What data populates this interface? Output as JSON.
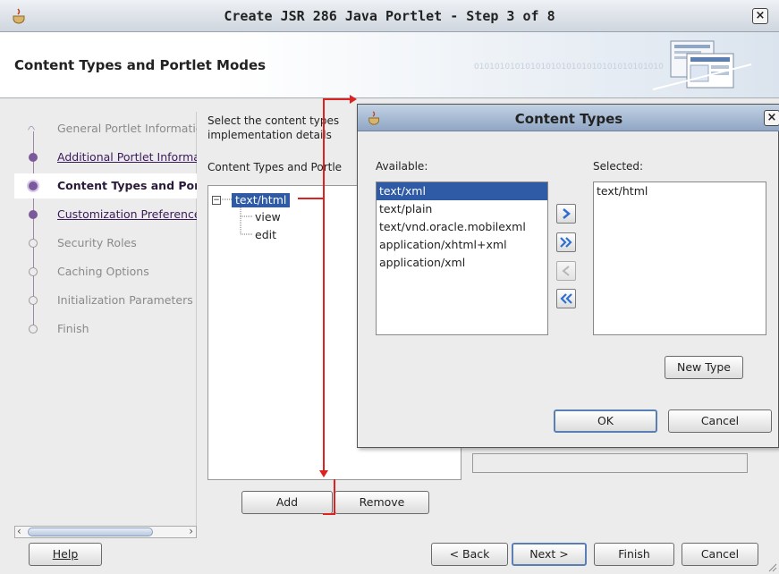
{
  "window": {
    "title": "Create JSR 286 Java Portlet - Step 3 of 8",
    "close_glyph": "×"
  },
  "banner": {
    "title": "Content Types and Portlet Modes",
    "binary_text": "0101010101010101010101010101010101010"
  },
  "wizard_steps": [
    {
      "label": "General Portlet Information",
      "state": "first"
    },
    {
      "label": "Additional Portlet Information",
      "state": "done"
    },
    {
      "label": "Content Types and Portlet Modes",
      "state": "current"
    },
    {
      "label": "Customization Preferences",
      "state": "done"
    },
    {
      "label": "Security Roles",
      "state": "todo"
    },
    {
      "label": "Caching Options",
      "state": "todo"
    },
    {
      "label": "Initialization Parameters",
      "state": "todo"
    },
    {
      "label": "Finish",
      "state": "todo"
    }
  ],
  "content": {
    "description_line1": "Select the content types",
    "description_line2": "implementation details",
    "tree_label": "Content Types and Portlet Modes:",
    "tree": {
      "root": "text/html",
      "children": [
        "view",
        "edit"
      ]
    },
    "add_label": "Add",
    "remove_label": "Remove"
  },
  "dialog": {
    "title": "Content Types",
    "close_glyph": "×",
    "available_label": "Available:",
    "selected_label": "Selected:",
    "available": [
      "text/xml",
      "text/plain",
      "text/vnd.oracle.mobilexml",
      "application/xhtml+xml",
      "application/xml"
    ],
    "available_selected_index": 0,
    "selected": [
      "text/html"
    ],
    "move_right": "›",
    "move_all_right": "»",
    "move_left": "‹",
    "move_all_left": "«",
    "new_type_label": "New Type",
    "ok_label": "OK",
    "cancel_label": "Cancel"
  },
  "footer": {
    "help_label": "Help",
    "back_label": "< Back",
    "next_label": "Next >",
    "finish_label": "Finish",
    "cancel_label": "Cancel"
  },
  "colors": {
    "selection": "#2e5aa6",
    "annotation_red": "#dd2222",
    "wizard_purple": "#7a5a9a"
  }
}
